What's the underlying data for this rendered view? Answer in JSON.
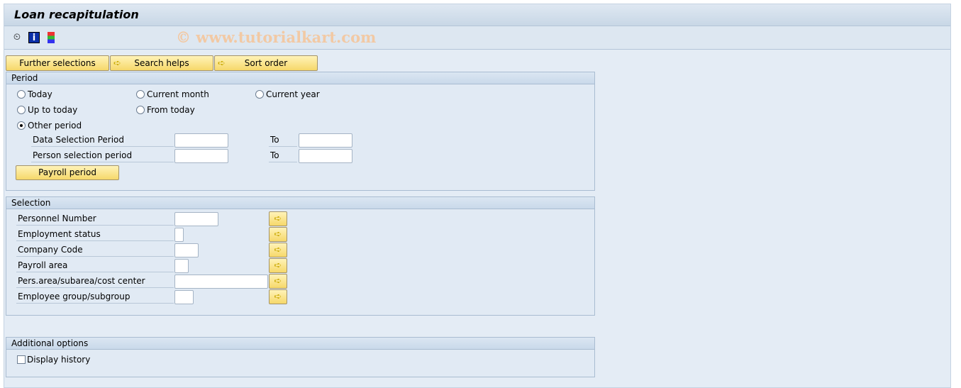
{
  "title": "Loan recapitulation",
  "watermark": "© www.tutorialkart.com",
  "toolbar": {
    "icons": [
      "execute-clock-icon",
      "info-icon",
      "selection-options-icon"
    ]
  },
  "tabs": {
    "further": "Further selections",
    "search": "Search helps",
    "sort": "Sort order"
  },
  "period": {
    "header": "Period",
    "today": "Today",
    "current_month": "Current month",
    "current_year": "Current year",
    "up_to_today": "Up to today",
    "from_today": "From today",
    "other_period": "Other period",
    "selected": "Other period",
    "data_sel": "Data Selection Period",
    "person_sel": "Person selection period",
    "to": "To",
    "data_from": "",
    "data_to": "",
    "person_from": "",
    "person_to": "",
    "payroll_btn": "Payroll period"
  },
  "selection": {
    "header": "Selection",
    "fields": [
      {
        "label": "Personnel Number",
        "value": ""
      },
      {
        "label": "Employment status",
        "value": ""
      },
      {
        "label": "Company Code",
        "value": ""
      },
      {
        "label": "Payroll area",
        "value": ""
      },
      {
        "label": "Pers.area/subarea/cost center",
        "value": ""
      },
      {
        "label": "Employee group/subgroup",
        "value": ""
      }
    ]
  },
  "additional": {
    "header": "Additional options",
    "display_history": "Display history",
    "display_history_checked": false
  }
}
